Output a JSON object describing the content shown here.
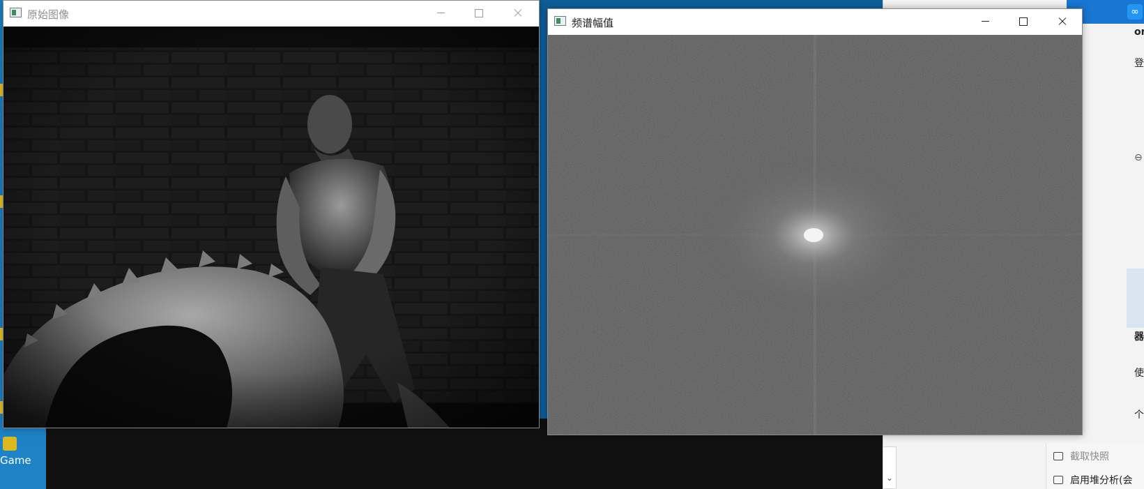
{
  "desktop": {
    "game_label": "Game"
  },
  "background_app": {
    "fragments": [
      "登",
      "器",
      "使",
      "个",
      "on",
      "⊖"
    ],
    "menu_items": [
      {
        "label": "截取快照",
        "icon": "camera-icon",
        "disabled": true
      },
      {
        "label": "启用堆分析(会",
        "icon": "heap-analysis-icon",
        "disabled": false
      }
    ],
    "scroll_arrow": "⌄"
  },
  "windows": [
    {
      "id": "original",
      "title": "原始图像",
      "active": false,
      "content": "grayscale photograph of a muscular man flipping a large tractor tire in front of a brick wall"
    },
    {
      "id": "spectrum",
      "title": "频谱幅值",
      "active": true,
      "content": "fourier magnitude spectrum, bright centre with faint cross axes on grey noise"
    }
  ],
  "colors": {
    "spectrum_bg": "#5a5a5a",
    "desktop_blue": "#1b80c8",
    "title_active": "#222222",
    "title_inactive": "#909090"
  }
}
